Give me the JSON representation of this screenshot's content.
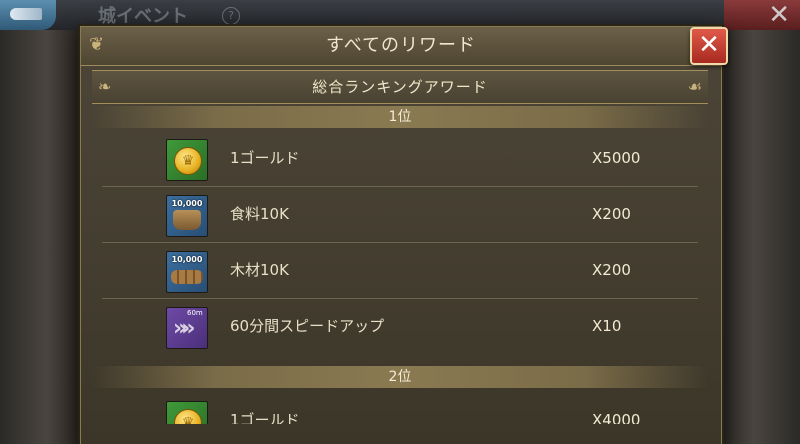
{
  "background": {
    "screen_title": "城イベント",
    "help_label": "?",
    "close_glyph": "✕"
  },
  "modal": {
    "title": "すべてのリワード",
    "close_glyph": "✕",
    "section_title": "総合ランキングアワード",
    "ranks": [
      {
        "label": "1位",
        "rewards": [
          {
            "icon": "gold-coin-icon",
            "name": "1ゴールド",
            "qty": "X5000"
          },
          {
            "icon": "food-10k-icon",
            "badge": "10,000",
            "name": "食料10K",
            "qty": "X200"
          },
          {
            "icon": "wood-10k-icon",
            "badge": "10,000",
            "name": "木材10K",
            "qty": "X200"
          },
          {
            "icon": "speedup-60m-icon",
            "badge": "60m",
            "name": "60分間スピードアップ",
            "qty": "X10"
          }
        ]
      },
      {
        "label": "2位",
        "rewards": [
          {
            "icon": "gold-coin-icon",
            "name": "1ゴールド",
            "qty": "X4000"
          }
        ]
      }
    ]
  },
  "colors": {
    "panel": "#4d4638",
    "gold_border": "#a48f5c",
    "close_red": "#c83a2c"
  }
}
